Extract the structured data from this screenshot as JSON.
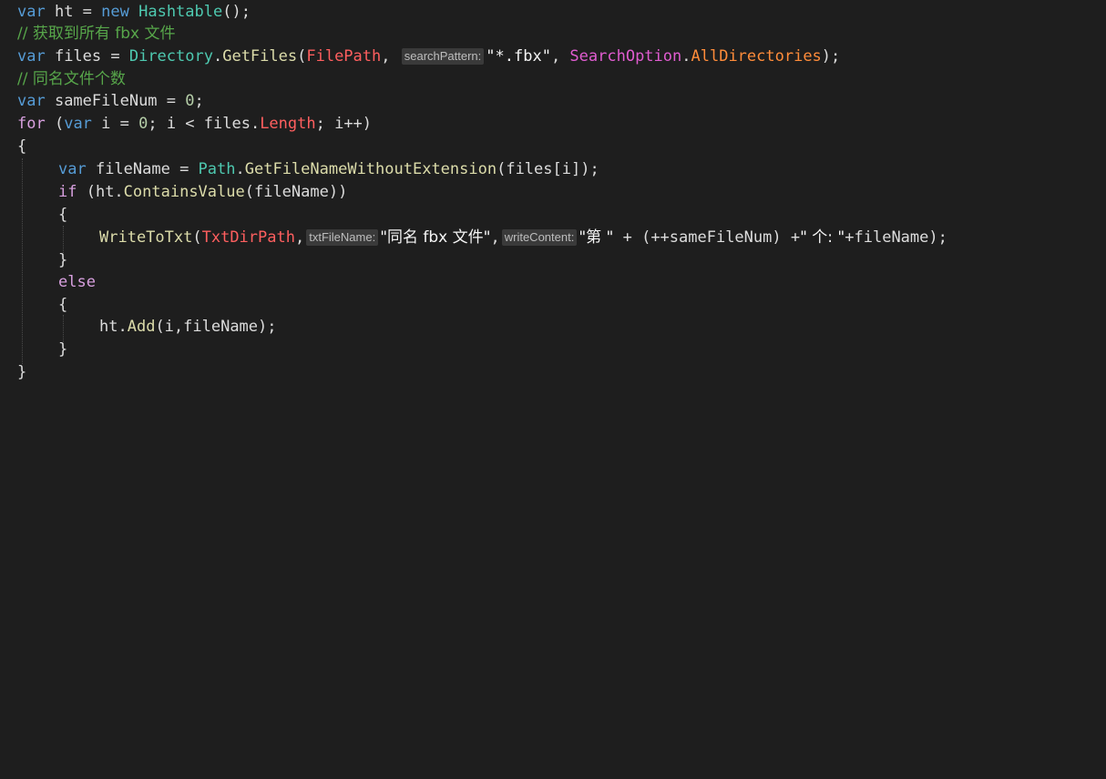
{
  "code": {
    "l1": {
      "a": "var",
      "b": " ht = ",
      "c": "new",
      "d": " ",
      "e": "Hashtable",
      "f": "();"
    },
    "l2": {
      "a": "// 获取到所有 fbx 文件"
    },
    "l3": {
      "a": "var",
      "b": " files = ",
      "c": "Directory",
      "d": ".",
      "e": "GetFiles",
      "f": "(",
      "g": "FilePath",
      "h": ", ",
      "hint": "searchPattern:",
      "i": "\"*.fbx\"",
      "j": ", ",
      "k": "SearchOption",
      "l": ".",
      "m": "AllDirectories",
      "n": ");"
    },
    "l4": {
      "a": "// 同名文件个数"
    },
    "l5": {
      "a": "var",
      "b": " sameFileNum = ",
      "c": "0",
      "d": ";"
    },
    "l6": {
      "a": "for",
      "b": " (",
      "c": "var",
      "d": " i = ",
      "e": "0",
      "f": "; i < files.",
      "g": "Length",
      "h": "; i++)"
    },
    "l7": {
      "a": "{"
    },
    "l8": {
      "a": "var",
      "b": " fileName = ",
      "c": "Path",
      "d": ".",
      "e": "GetFileNameWithoutExtension",
      "f": "(files[i]);"
    },
    "l9": {
      "a": "if",
      "b": " (ht.",
      "c": "ContainsValue",
      "d": "(fileName))"
    },
    "l10": {
      "a": "{"
    },
    "l11": {
      "a": "WriteToTxt",
      "b": "(",
      "c": "TxtDirPath",
      "d": ",",
      "hint1": "txtFileName:",
      "e": "\"同名 fbx 文件\"",
      "f": ",",
      "hint2": "writeContent:",
      "g": "\"第 \"",
      "h": " + (++sameFileNum) +",
      "i": "\" 个: \"",
      "j": "+fileName);"
    },
    "l12": {
      "a": "}"
    },
    "l13": {
      "a": "else"
    },
    "l14": {
      "a": "{"
    },
    "l15": {
      "a": "ht.",
      "b": "Add",
      "c": "(i,fileName);"
    },
    "l16": {
      "a": "}"
    },
    "l17": {
      "a": "}"
    }
  },
  "colors": {
    "background": "#1e1e1e",
    "keyword": "#569cd6",
    "comment": "#57a64a",
    "type": "#4ec9b0",
    "method": "#dcdcaa",
    "string": "#d69d85"
  }
}
